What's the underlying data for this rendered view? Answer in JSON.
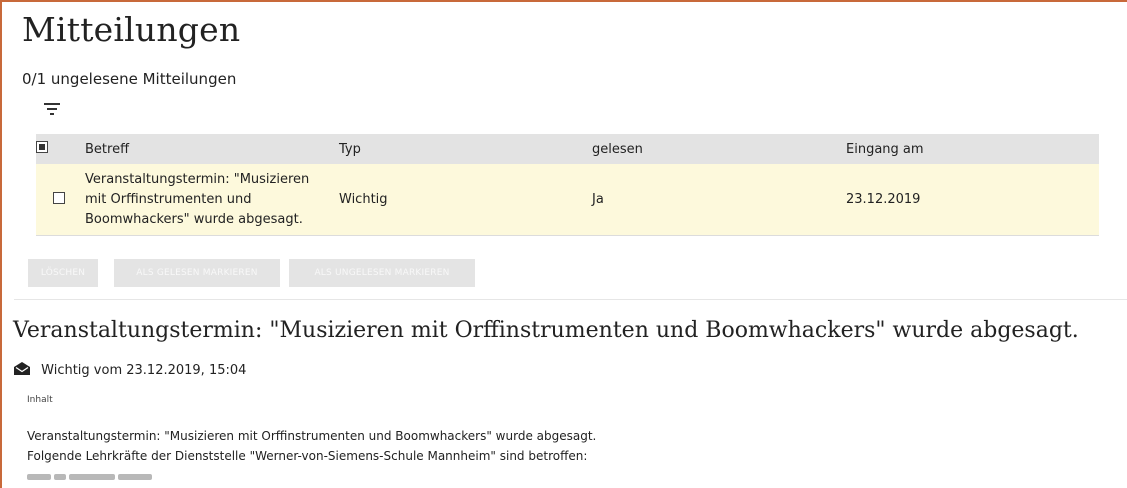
{
  "page": {
    "title": "Mitteilungen",
    "unread_summary": "0/1 ungelesene Mitteilungen"
  },
  "table": {
    "headers": {
      "betreff": "Betreff",
      "typ": "Typ",
      "gelesen": "gelesen",
      "eingang": "Eingang am"
    },
    "rows": [
      {
        "betreff": "Veranstaltungstermin: \"Musizieren mit Orffinstrumenten und Boomwhackers\" wurde abgesagt.",
        "typ": "Wichtig",
        "gelesen": "Ja",
        "eingang": "23.12.2019",
        "selected": false
      }
    ]
  },
  "actions": {
    "delete": "LÖSCHEN",
    "mark_read": "ALS GELESEN MARKIEREN",
    "mark_unread": "ALS UNGELESEN MARKIEREN"
  },
  "detail": {
    "title": "Veranstaltungstermin: \"Musizieren mit Orffinstrumenten und Boomwhackers\" wurde abgesagt.",
    "meta": "Wichtig vom 23.12.2019, 15:04",
    "icon": "envelope-open-icon",
    "content_label": "Inhalt",
    "content_lines": [
      "Veranstaltungstermin: \"Musizieren mit Orffinstrumenten und Boomwhackers\" wurde abgesagt.",
      "Folgende Lehrkräfte der Dienststelle \"Werner-von-Siemens-Schule Mannheim\" sind betroffen:"
    ]
  },
  "colors": {
    "accent_border": "#c8693a",
    "header_bg": "#e3e3e3",
    "row_highlight": "#fdf9dc",
    "button_disabled": "#e4e4e4"
  }
}
